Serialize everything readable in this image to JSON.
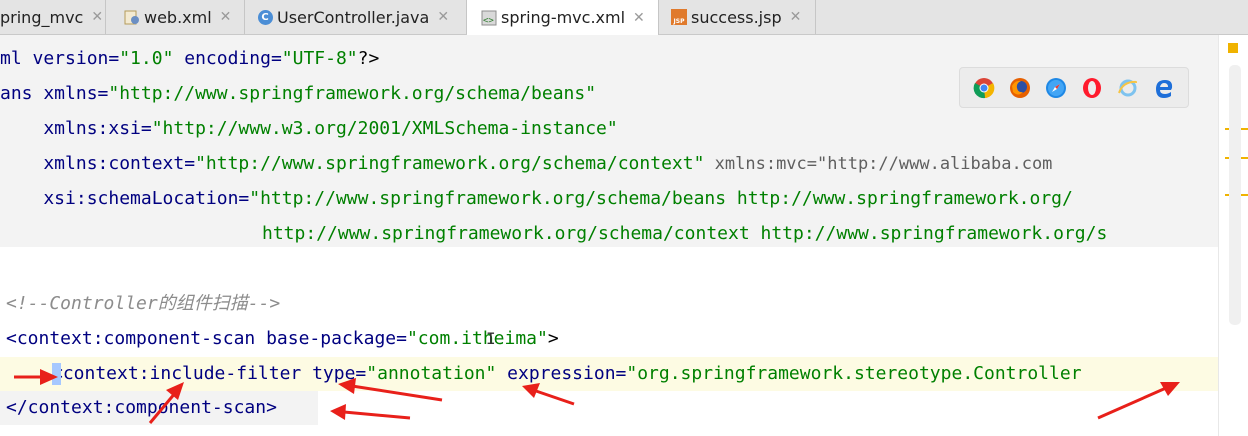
{
  "tabs": [
    {
      "label": "pring_mvc",
      "icon": "module-icon"
    },
    {
      "label": "web.xml",
      "icon": "web-xml-icon"
    },
    {
      "label": "UserController.java",
      "icon": "class-icon"
    },
    {
      "label": "spring-mvc.xml",
      "icon": "xml-file-icon",
      "active": true
    },
    {
      "label": "success.jsp",
      "icon": "jsp-icon"
    }
  ],
  "code": {
    "l1_a": "ml version=",
    "l1_b": "\"1.0\"",
    "l1_c": " encoding=",
    "l1_d": "\"UTF-8\"",
    "l1_e": "?>",
    "l2_a": "ans xmlns=",
    "l2_b": "\"http://www.springframework.org/schema/beans\"",
    "l3_a": "    xmlns:xsi=",
    "l3_b": "\"http://www.w3.org/2001/XMLSchema-instance\"",
    "l4_a": "    xmlns:context=",
    "l4_b": "\"http://www.springframework.org/schema/context\"",
    "l4_c": " xmlns:mvc=\"http://www.alibaba.com",
    "l5_a": "    xsi:schemaLocation=",
    "l5_b": "\"http://www.springframework.org/schema/beans http://www.springframework.org/",
    "l6_a": "http://www.springframework.org/schema/context http://www.springframework.org/s",
    "l7_a": "<!--Controller的组件扫描-->",
    "l8_a": "<context:component-scan base-package=",
    "l8_b": "\"com.itheima\"",
    "l8_c": ">",
    "l9_a": "<context:include-filter type=",
    "l9_b": "\"annotation\"",
    "l9_c": " expression=",
    "l9_d": "\"org.springframework.stereotype.Controller",
    "l10_a": "</context:component-scan>"
  },
  "browsers": [
    "chrome-icon",
    "firefox-icon",
    "safari-icon",
    "opera-icon",
    "ie-icon",
    "edge-icon"
  ],
  "colors": {
    "tag": "#000080",
    "string": "#008000",
    "comment": "#8c8c8c",
    "arrow": "#e8201a",
    "highlight": "#fdfbe3",
    "shaded": "#f3f3f3"
  }
}
